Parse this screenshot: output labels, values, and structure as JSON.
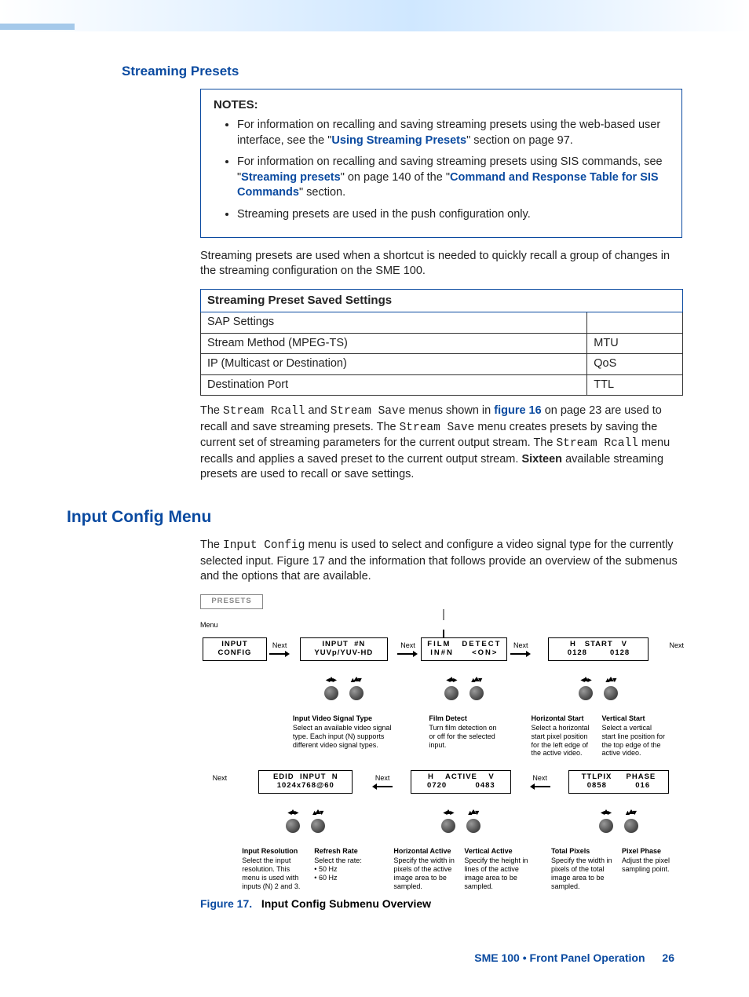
{
  "headings": {
    "streaming_presets": "Streaming Presets",
    "input_config_menu": "Input Config Menu"
  },
  "notes": {
    "label": "NOTES:",
    "items": [
      {
        "pre": "For information on recalling and saving streaming presets using the web-based user interface, see the \"",
        "link": "Using Streaming Presets",
        "post": "\" section on page 97."
      },
      {
        "pre": "For information on recalling and saving streaming presets using SIS commands, see \"",
        "link": "Streaming presets",
        "mid": "\" on page 140 of the \"",
        "link2": "Command and Response Table for SIS Commands",
        "post": "\" section."
      },
      {
        "pre": "Streaming presets are used in the push configuration only.",
        "link": "",
        "post": ""
      }
    ]
  },
  "para1": "Streaming presets are used when a shortcut is needed to quickly recall a group of changes in the streaming configuration on the SME 100.",
  "table": {
    "header": "Streaming Preset Saved Settings",
    "rows": [
      [
        "SAP Settings",
        ""
      ],
      [
        "Stream Method (MPEG-TS)",
        "MTU"
      ],
      [
        "IP (Multicast or Destination)",
        "QoS"
      ],
      [
        "Destination Port",
        "TTL"
      ]
    ]
  },
  "para2": {
    "a": "The ",
    "m1": "Stream Rcall",
    "b": " and ",
    "m2": "Stream Save",
    "c": " menus shown in ",
    "link": "figure 16",
    "d": " on page 23 are used to recall and save streaming presets. The ",
    "m3": "Stream Save",
    "e": " menu creates presets by saving the current set of streaming parameters for the current output stream. The ",
    "m4": "Stream Rcall",
    "f": " menu recalls and applies a saved preset to the current output stream. ",
    "bold": "Sixteen",
    "g": " available streaming presets are used to recall or save settings."
  },
  "para3": {
    "a": "The ",
    "m1": "Input Config",
    "b": " menu is used to select and configure a video signal type for the currently selected input. Figure 17 and the information that follows provide an overview of the submenus and the options that are available."
  },
  "figure_caption": {
    "num": "Figure 17.",
    "title": "Input Config Submenu Overview"
  },
  "footer": {
    "book": "SME 100 • Front Panel Operation",
    "page": "26"
  },
  "diagram": {
    "presets": "PRESETS",
    "menu_label": "Menu",
    "next": "Next",
    "row1": [
      {
        "title": "INPUT\nCONFIG"
      },
      {
        "title": "INPUT  #N\nYUVp/YUV-HD",
        "desc_h": "Input Video Signal Type",
        "desc_b": "Select an available video signal type. Each input (N) supports different video signal types."
      },
      {
        "title": "FILM   DETECT\nIN#N     <ON>",
        "desc_h": "Film Detect",
        "desc_b": "Turn film detection on or off for the selected input."
      },
      {
        "title": "H   START   V\n0128        0128",
        "desc_h1": "Horizontal Start",
        "desc_b1": "Select a horizontal start pixel position for the left edge of the active video.",
        "desc_h2": "Vertical Start",
        "desc_b2": "Select a vertical start line position for the top edge of the active video."
      }
    ],
    "row2": [
      {
        "title": "EDID  INPUT  N\n1024x768@60",
        "desc_h1": "Input Resolution",
        "desc_b1": "Select the input resolution. This menu is used with inputs (N) 2 and 3.",
        "desc_h2": "Refresh Rate",
        "desc_b2": "Select the rate:",
        "bullets": [
          "50 Hz",
          "60 Hz"
        ]
      },
      {
        "title": "H    ACTIVE    V\n0720          0483",
        "desc_h1": "Horizontal Active",
        "desc_b1": "Specify the width in pixels of the active image area to be sampled.",
        "desc_h2": "Vertical Active",
        "desc_b2": "Specify the height in lines of the active image area to be sampled."
      },
      {
        "title": "TTLPIX     PHASE\n0858          016",
        "desc_h1": "Total Pixels",
        "desc_b1": "Specify the width in pixels of the total image area to be sampled.",
        "desc_h2": "Pixel Phase",
        "desc_b2": "Adjust the pixel sampling point."
      }
    ]
  }
}
